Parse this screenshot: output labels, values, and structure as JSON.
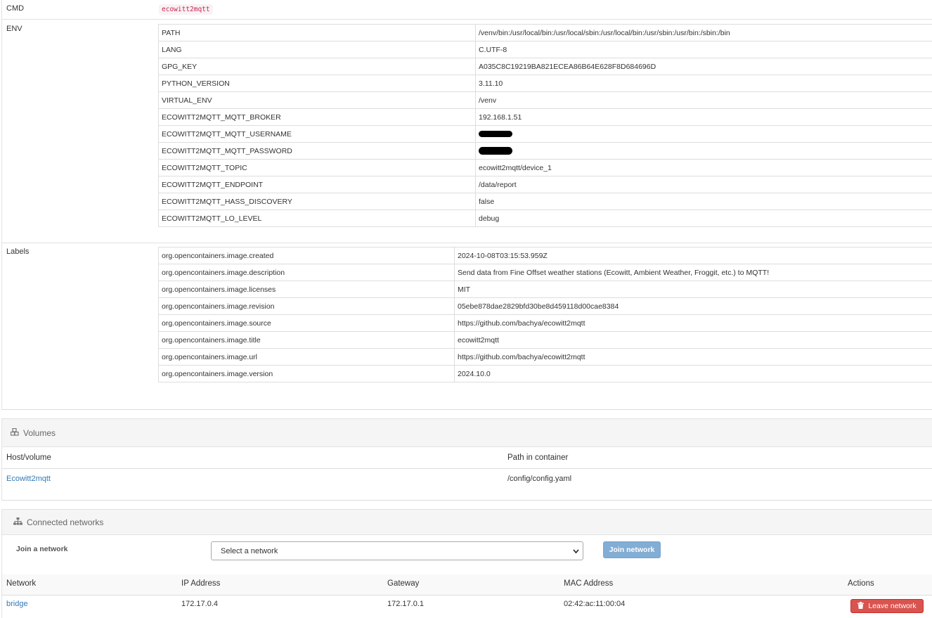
{
  "cmd": {
    "label": "CMD",
    "value": "ecowitt2mqtt"
  },
  "env": {
    "label": "ENV",
    "rows": [
      {
        "key": "PATH",
        "value": "/venv/bin:/usr/local/bin:/usr/local/sbin:/usr/local/bin:/usr/sbin:/usr/bin:/sbin:/bin"
      },
      {
        "key": "LANG",
        "value": "C.UTF-8"
      },
      {
        "key": "GPG_KEY",
        "value": "A035C8C19219BA821ECEA86B64E628F8D684696D"
      },
      {
        "key": "PYTHON_VERSION",
        "value": "3.11.10"
      },
      {
        "key": "VIRTUAL_ENV",
        "value": "/venv"
      },
      {
        "key": "ECOWITT2MQTT_MQTT_BROKER",
        "value": "192.168.1.51"
      },
      {
        "key": "ECOWITT2MQTT_MQTT_USERNAME",
        "value": ""
      },
      {
        "key": "ECOWITT2MQTT_MQTT_PASSWORD",
        "value": ""
      },
      {
        "key": "ECOWITT2MQTT_TOPIC",
        "value": "ecowitt2mqtt/device_1"
      },
      {
        "key": "ECOWITT2MQTT_ENDPOINT",
        "value": "/data/report"
      },
      {
        "key": "ECOWITT2MQTT_HASS_DISCOVERY",
        "value": "false"
      },
      {
        "key": "ECOWITT2MQTT_LO_LEVEL",
        "value": "debug"
      }
    ]
  },
  "labels": {
    "label": "Labels",
    "rows": [
      {
        "key": "org.opencontainers.image.created",
        "value": "2024-10-08T03:15:53.959Z"
      },
      {
        "key": "org.opencontainers.image.description",
        "value": "Send data from Fine Offset weather stations (Ecowitt, Ambient Weather, Froggit, etc.) to MQTT!"
      },
      {
        "key": "org.opencontainers.image.licenses",
        "value": "MIT"
      },
      {
        "key": "org.opencontainers.image.revision",
        "value": "05ebe878dae2829bfd30be8d459118d00cae8384"
      },
      {
        "key": "org.opencontainers.image.source",
        "value": "https://github.com/bachya/ecowitt2mqtt"
      },
      {
        "key": "org.opencontainers.image.title",
        "value": "ecowitt2mqtt"
      },
      {
        "key": "org.opencontainers.image.url",
        "value": "https://github.com/bachya/ecowitt2mqtt"
      },
      {
        "key": "org.opencontainers.image.version",
        "value": "2024.10.0"
      }
    ]
  },
  "volumes": {
    "title": "Volumes",
    "icon": "cubes-icon",
    "headers": {
      "host": "Host/volume",
      "path": "Path in container"
    },
    "row": {
      "host": "Ecowitt2mqtt",
      "path": "/config/config.yaml"
    }
  },
  "networks": {
    "title": "Connected networks",
    "icon": "sitemap-icon",
    "join_label": "Join a network",
    "select_placeholder": "Select a network",
    "join_button": "Join network",
    "headers": {
      "network": "Network",
      "ip": "IP Address",
      "gateway": "Gateway",
      "mac": "MAC Address",
      "actions": "Actions"
    },
    "row": {
      "network": "bridge",
      "ip": "172.17.0.4",
      "gateway": "172.17.0.1",
      "mac": "02:42:ac:11:00:04",
      "action": "Leave network"
    }
  },
  "colors": {
    "link": "#337ab7",
    "danger": "#d9534f",
    "join_button": "#82add4",
    "code": "#c7254e"
  }
}
